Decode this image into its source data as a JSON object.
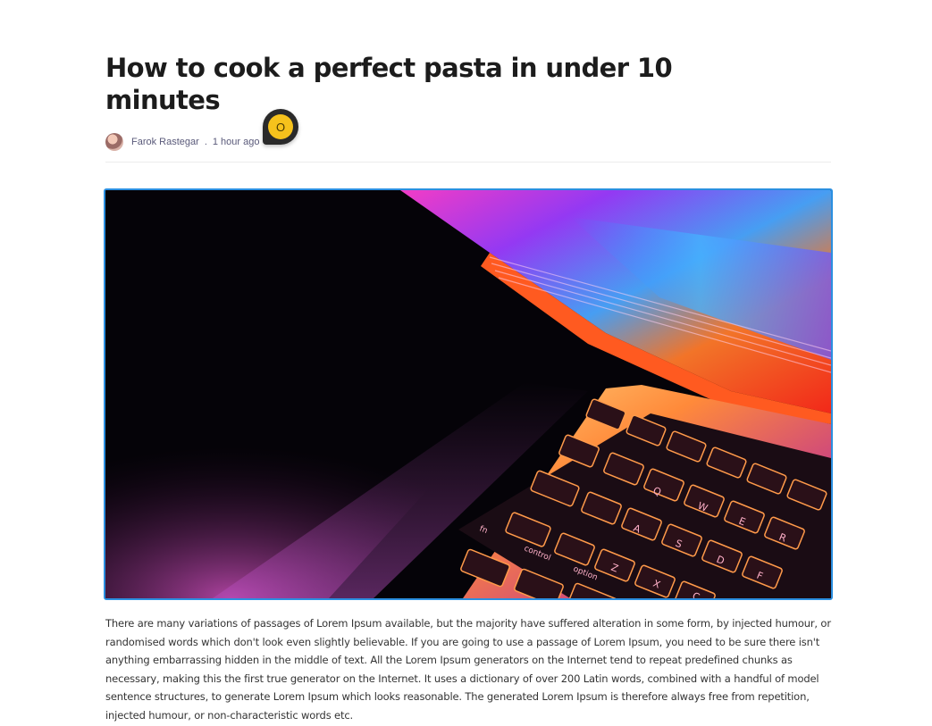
{
  "article": {
    "title": "How to cook a perfect pasta in under 10 minutes",
    "author": "Farok Rastegar",
    "separator": ".",
    "time": "1 hour ago",
    "comment_badge": "O",
    "body": "There are many variations of passages of Lorem Ipsum available, but the majority have suffered alteration in some form, by injected humour, or randomised words which don't look even slightly believable. If you are going to use a passage of Lorem Ipsum, you need to be sure there isn't anything embarrassing hidden in the middle of text. All the Lorem Ipsum generators on the Internet tend to repeat predefined chunks as necessary, making this the first true generator on the Internet. It uses a dictionary of over 200 Latin words, combined with a handful of model sentence structures, to generate Lorem Ipsum which looks reasonable. The generated Lorem Ipsum is therefore always free from repetition, injected humour, or non-characteristic words etc."
  },
  "keyboard_keys": {
    "fn": "fn",
    "control": "control",
    "option": "option",
    "q": "Q",
    "w": "W",
    "e": "E",
    "r": "R",
    "a": "A",
    "s": "S",
    "d": "D",
    "f": "F",
    "z": "Z",
    "x": "X",
    "c": "C"
  },
  "colors": {
    "selection_border": "#2b8fe0",
    "badge": "#f6c21c",
    "title": "#1c1c1c",
    "meta": "#5a5a7a"
  }
}
